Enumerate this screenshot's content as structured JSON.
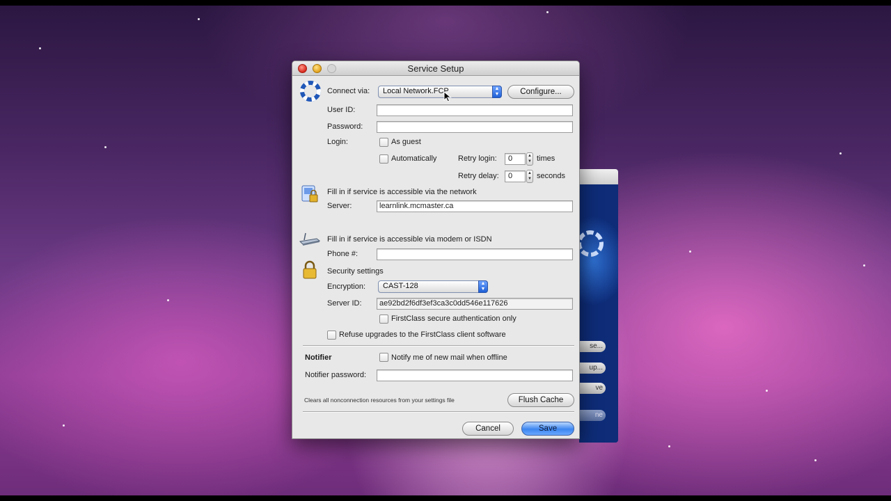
{
  "dialog": {
    "title": "Service Setup",
    "connect_via_label": "Connect via:",
    "connect_via_value": "Local Network.FCP",
    "configure_label": "Configure...",
    "user_id_label": "User ID:",
    "user_id_value": "",
    "password_label": "Password:",
    "password_value": "",
    "login_label": "Login:",
    "as_guest_label": "As guest",
    "automatically_label": "Automatically",
    "retry_login_label": "Retry login:",
    "retry_login_value": "0",
    "times_label": "times",
    "retry_delay_label": "Retry delay:",
    "retry_delay_value": "0",
    "seconds_label": "seconds",
    "network_note": "Fill in if service is accessible via the network",
    "server_label": "Server:",
    "server_value": "learnlink.mcmaster.ca",
    "modem_note": "Fill in if service is accessible via modem or ISDN",
    "phone_label": "Phone #:",
    "phone_value": "",
    "security_heading": "Security settings",
    "encryption_label": "Encryption:",
    "encryption_value": "CAST-128",
    "server_id_label": "Server ID:",
    "server_id_value": "ae92bd2f6df3ef3ca3c0dd546e117626",
    "secure_auth_label": "FirstClass secure authentication only",
    "refuse_upgrades_label": "Refuse upgrades to the FirstClass client software",
    "notifier_heading": "Notifier",
    "notify_label": "Notify me of new mail when offline",
    "notifier_password_label": "Notifier password:",
    "notifier_password_value": "",
    "cache_note": "Clears all nonconnection resources from your settings file",
    "flush_cache_label": "Flush Cache",
    "cancel_label": "Cancel",
    "save_label": "Save"
  },
  "background_window": {
    "buttons": [
      "se...",
      "up...",
      "ve",
      "ne"
    ]
  },
  "colors": {
    "accent": "#3d86f0",
    "desktop": "#8e3d95"
  }
}
